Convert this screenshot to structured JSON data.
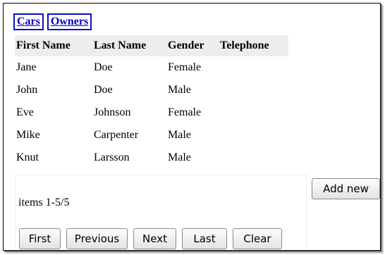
{
  "tabs": [
    {
      "label": "Cars"
    },
    {
      "label": "Owners"
    }
  ],
  "table": {
    "headers": [
      "First Name",
      "Last Name",
      "Gender",
      "Telephone"
    ],
    "rows": [
      [
        "Jane",
        "Doe",
        "Female",
        ""
      ],
      [
        "John",
        "Doe",
        "Male",
        ""
      ],
      [
        "Eve",
        "Johnson",
        "Female",
        ""
      ],
      [
        "Mike",
        "Carpenter",
        "Male",
        ""
      ],
      [
        "Knut",
        "Larsson",
        "Male",
        ""
      ]
    ]
  },
  "pager": {
    "items_label": "items 1-5/5",
    "first": "First",
    "previous": "Previous",
    "next": "Next",
    "last": "Last",
    "clear": "Clear"
  },
  "actions": {
    "add_new": "Add new"
  },
  "colors": {
    "link": "#0000cc",
    "tab_border": "#1010c0",
    "header_bg": "#ededed"
  }
}
